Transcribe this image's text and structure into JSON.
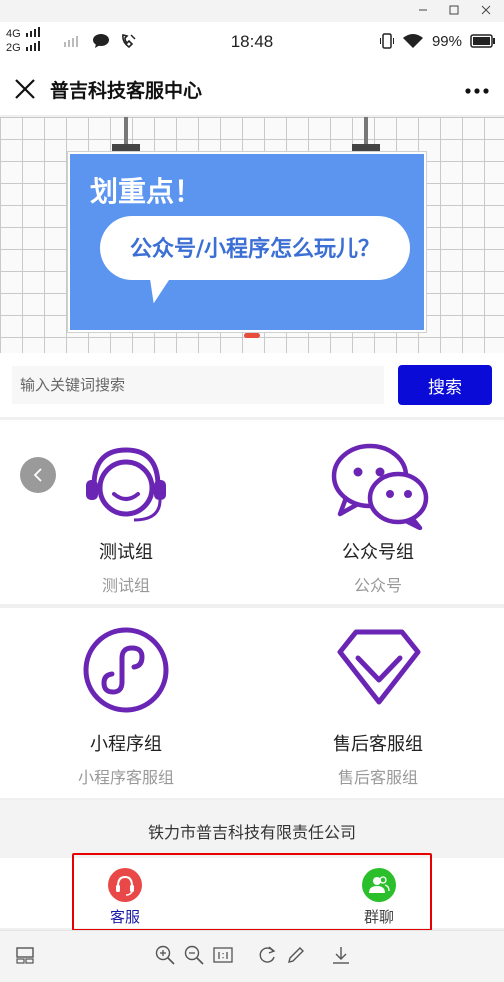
{
  "status_bar": {
    "network_top": "4G",
    "network_bottom": "2G",
    "time": "18:48",
    "battery": "99%"
  },
  "header": {
    "title": "普吉科技客服中心"
  },
  "banner": {
    "headline": "划重点！",
    "bubble_text": "公众号/小程序怎么玩儿？",
    "slide_index": 1,
    "slide_count": 1
  },
  "search": {
    "placeholder": "输入关键词搜索",
    "value": "",
    "button_label": "搜索"
  },
  "groups": [
    {
      "name": "测试组",
      "subtitle": "测试组",
      "icon": "headset-icon"
    },
    {
      "name": "公众号组",
      "subtitle": "公众号",
      "icon": "wechat-icon"
    },
    {
      "name": "小程序组",
      "subtitle": "小程序客服组",
      "icon": "mini-program-icon"
    },
    {
      "name": "售后客服组",
      "subtitle": "售后客服组",
      "icon": "diamond-icon"
    }
  ],
  "footer": {
    "company": "铁力市普吉科技有限责任公司"
  },
  "tabbar": {
    "tabs": [
      {
        "label": "客服",
        "icon": "headset-icon",
        "color": "#e94848",
        "active": true,
        "label_color": "#1a1aa8"
      },
      {
        "label": "群聊",
        "icon": "people-icon",
        "color": "#2bbf2b",
        "active": false,
        "label_color": "#444444"
      }
    ]
  },
  "colors": {
    "accent_purple": "#6a25b5",
    "search_button": "#0b0bd8",
    "highlight_frame": "#e60000",
    "banner_board": "#5b95f0"
  }
}
